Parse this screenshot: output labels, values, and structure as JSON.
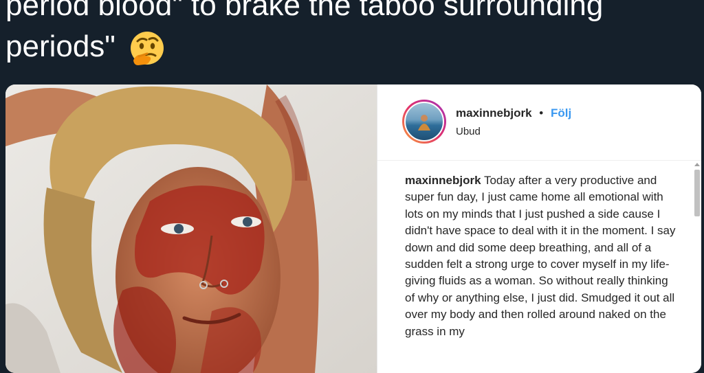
{
  "tweet": {
    "line1": "period blood\" to brake the taboo surrounding",
    "line2": "periods\"",
    "emoji_icon": "thinking-face-icon"
  },
  "instagram_post": {
    "photo": "woman-face-covered-in-red-photo",
    "header": {
      "username": "maxinnebjork",
      "separator": "•",
      "follow_label": "Följ",
      "location": "Ubud"
    },
    "caption": {
      "username": "maxinnebjork",
      "text": "Today after a very productive and super fun day, I just came home all emotional with lots on my minds that I just pushed a side cause I didn't have space to deal with it in the moment. I say down and did some deep breathing, and all of a sudden felt a strong urge to cover myself in my life-giving fluids as a woman. So without really thinking of why or anything else, I just did. Smudged it out all over my body and then rolled around naked on the grass in my"
    }
  },
  "colors": {
    "tweet_background": "#15202b",
    "follow_blue": "#3897f0",
    "text_dark": "#262626"
  }
}
